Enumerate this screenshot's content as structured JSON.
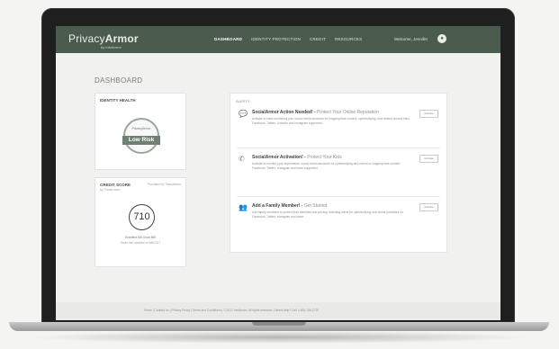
{
  "nav": {
    "logo_privacy": "Privacy",
    "logo_armor": "Armor",
    "logo_sub": "by InfoArmor",
    "items": [
      {
        "label": "Dashboard"
      },
      {
        "label": "Identity Protection"
      },
      {
        "label": "Credit"
      },
      {
        "label": "Resources"
      }
    ],
    "user_name": "Welcome, Jennifer",
    "avatar_glyph": "●"
  },
  "page": {
    "title": "DASHBOARD"
  },
  "identity_health": {
    "title": "IDENTITY HEALTH",
    "badge_logo": "PrivacyArmor",
    "status": "Low Risk"
  },
  "credit_score": {
    "title": "CREDIT SCORE",
    "subtitle": "by TransUnion",
    "provider": "Provided by TransUnion",
    "score": "710",
    "scale": "Excellent 300 Good 850",
    "updated": "Score last updated on 5/8/2017"
  },
  "alerts": {
    "label": "ALERTS",
    "items": [
      {
        "icon": "chat-icon",
        "glyph": "💬",
        "title": "SocialArmor Action Needed!",
        "tag": "Protect Your Online Reputation",
        "description": "Activate to start monitoring your social media accounts for inappropriate content, cyberbullying, and related privacy risks. Facebook, Twitter, LinkedIn and Instagram supported.",
        "button": "Activate"
      },
      {
        "icon": "phone-icon",
        "glyph": "✆",
        "title": "SocialArmor Activation!",
        "tag": "Protect Your Kids",
        "description": "Activate to monitor your dependents' social media accounts for cyberbullying and violent or inappropriate content. Facebook, Twitter, Instagram and more supported.",
        "button": "Activate"
      },
      {
        "icon": "family-icon",
        "glyph": "👥",
        "title": "Add a Family Member!",
        "tag": "Get Started",
        "description": "Add family members to protect their identities and privacy, including alerts for cyberbullying and online predators on Facebook, Twitter, Instagram and more.",
        "button": "Activate"
      }
    ]
  },
  "footer": {
    "text": "Home  |  Contact Us  |  Privacy Policy  |  Terms and Conditions  |  © 2017 InfoArmor. All rights reserved.  |  Need Help? Call 1-800-789-2720"
  }
}
